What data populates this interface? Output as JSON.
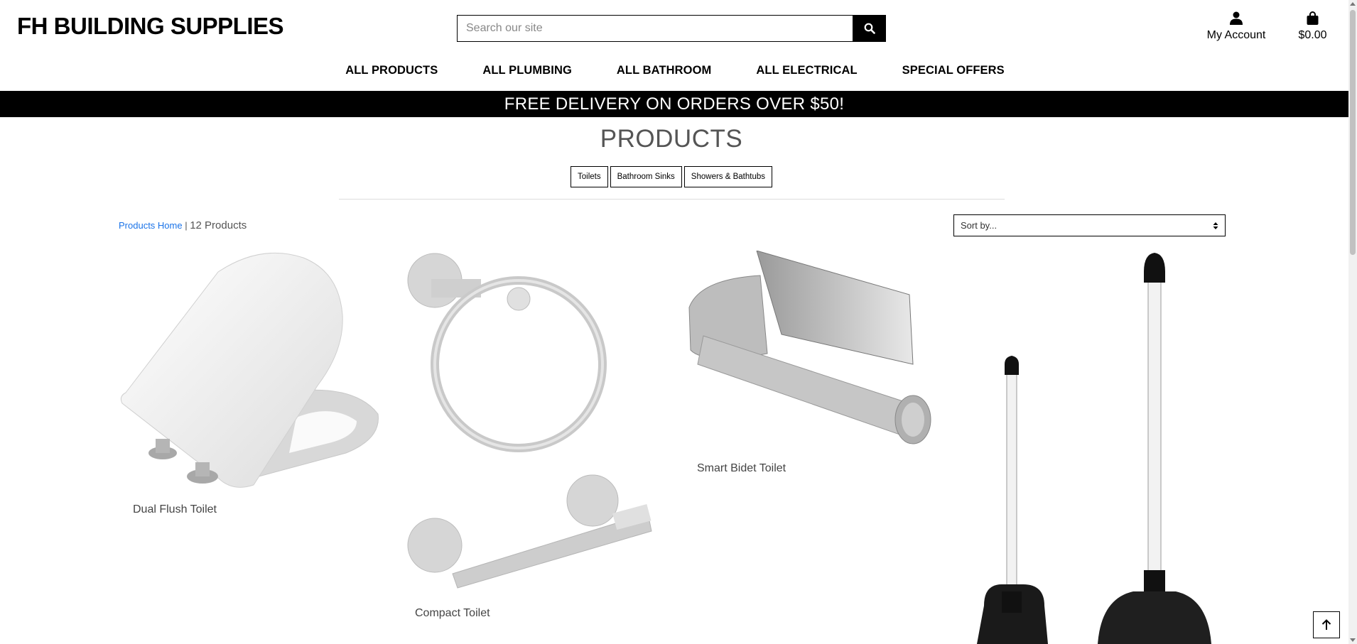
{
  "header": {
    "logo": "FH BUILDING SUPPLIES",
    "search_placeholder": "Search our site",
    "account_label": "My Account",
    "cart_total": "$0.00"
  },
  "nav": {
    "items": [
      "ALL PRODUCTS",
      "ALL PLUMBING",
      "ALL BATHROOM",
      "ALL ELECTRICAL",
      "SPECIAL OFFERS"
    ]
  },
  "banner": "FREE DELIVERY ON ORDERS OVER $50!",
  "page": {
    "title": "PRODUCTS",
    "categories": [
      "Toilets",
      "Bathroom Sinks",
      "Showers & Bathtubs"
    ],
    "breadcrumb_link": "Products Home",
    "separator": " | ",
    "product_count": "12 Products",
    "sort_label": "Sort by..."
  },
  "products": [
    {
      "name": "Dual Flush Toilet",
      "image": "toilet-seat"
    },
    {
      "name": "Compact Toilet",
      "image": "towel-ring-and-paper-holder"
    },
    {
      "name": "Smart Bidet Toilet",
      "image": "paper-holder"
    },
    {
      "name": "",
      "image": "plungers"
    }
  ],
  "colors": {
    "banner_bg": "#000000",
    "link": "#1a73e8"
  }
}
